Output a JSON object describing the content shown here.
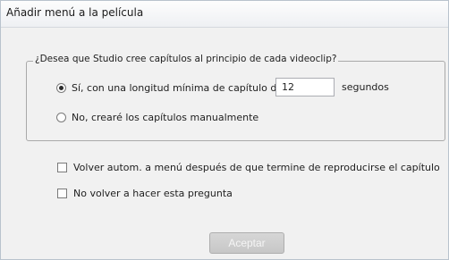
{
  "window": {
    "title": "Añadir menú a la película"
  },
  "chapters_group": {
    "label": "¿Desea que Studio cree capítulos al principio de cada videoclip?",
    "option_auto": {
      "label": "Sí, con una longitud mínima de capítulo de",
      "selected": true
    },
    "min_length_value": "12",
    "min_length_unit": "segundos",
    "option_manual": {
      "label": "No, crearé los capítulos manualmente",
      "selected": false
    }
  },
  "options": {
    "return_to_menu": {
      "label": "Volver autom. a menú después de que termine de reproducirse el capítulo",
      "checked": false
    },
    "dont_ask_again": {
      "label": "No volver a hacer esta pregunta",
      "checked": false
    }
  },
  "buttons": {
    "accept_label": "Aceptar"
  }
}
